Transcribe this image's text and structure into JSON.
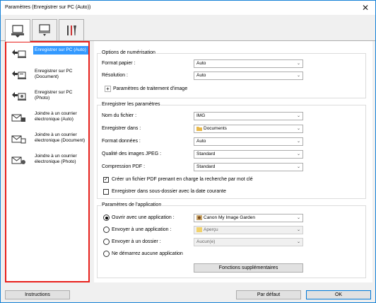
{
  "window": {
    "title": "Paramètres (Enregistrer sur PC (Auto))",
    "close_glyph": "✕"
  },
  "tabs": [
    {
      "name": "computer-tab-icon",
      "active": true
    },
    {
      "name": "scanner-tab-icon",
      "active": false
    },
    {
      "name": "tools-tab-icon",
      "active": false
    }
  ],
  "sidebar": {
    "items": [
      {
        "label": "Enregistrer sur PC (Auto)",
        "icon": "save-to-pc-auto-icon",
        "selected": true
      },
      {
        "label": "Enregistrer sur PC (Document)",
        "icon": "save-to-pc-document-icon",
        "selected": false
      },
      {
        "label": "Enregistrer sur PC (Photo)",
        "icon": "save-to-pc-photo-icon",
        "selected": false
      },
      {
        "label": "Joindre à un courrier électronique (Auto)",
        "icon": "attach-email-auto-icon",
        "selected": false
      },
      {
        "label": "Joindre à un courrier électronique (Document)",
        "icon": "attach-email-document-icon",
        "selected": false
      },
      {
        "label": "Joindre à un courrier électronique (Photo)",
        "icon": "attach-email-photo-icon",
        "selected": false
      }
    ]
  },
  "scan_options": {
    "title": "Options de numérisation",
    "paper_size_label": "Format papier :",
    "paper_size_value": "Auto",
    "resolution_label": "Résolution :",
    "resolution_value": "Auto",
    "image_processing_label": "Paramètres de traitement d'image",
    "plus_glyph": "+"
  },
  "save_settings": {
    "title": "Enregistrer les paramètres",
    "filename_label": "Nom du fichier :",
    "filename_value": "IMG",
    "save_in_label": "Enregistrer dans :",
    "save_in_value": "Documents",
    "data_format_label": "Format données :",
    "data_format_value": "Auto",
    "jpeg_quality_label": "Qualité des images JPEG :",
    "jpeg_quality_value": "Standard",
    "pdf_compression_label": "Compression PDF :",
    "pdf_compression_value": "Standard",
    "keyword_pdf_label": "Créer un fichier PDF prenant en charge la recherche par mot clé",
    "keyword_pdf_checked": true,
    "subfolder_label": "Enregistrer dans sous-dossier avec la date courante",
    "subfolder_checked": false,
    "check_glyph": "✓"
  },
  "app_settings": {
    "title": "Paramètres de l'application",
    "open_app_label": "Ouvrir avec une application :",
    "open_app_value": "Canon My Image Garden",
    "send_app_label": "Envoyer à une application :",
    "send_app_value": "Aperçu",
    "send_folder_label": "Envoyer à un dossier :",
    "send_folder_value": "Aucun(e)",
    "no_app_label": "Ne démarrez aucune application",
    "selected_option": "open_app",
    "more_functions_label": "Fonctions supplémentaires"
  },
  "footer": {
    "instructions_label": "Instructions",
    "defaults_label": "Par défaut",
    "ok_label": "OK"
  },
  "colors": {
    "highlight_border": "#e8201c",
    "selection": "#3399ff",
    "window_border": "#1883d7"
  },
  "arrow_glyph": "⌄"
}
